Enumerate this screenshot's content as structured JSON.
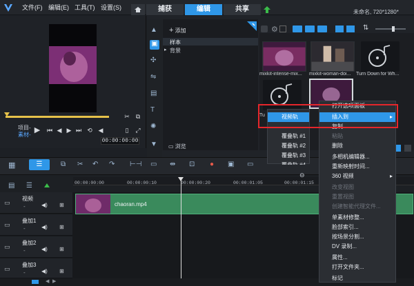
{
  "menubar": {
    "items": [
      "文件(F)",
      "编辑(E)",
      "工具(T)",
      "设置(S)"
    ]
  },
  "tabs": {
    "capture": "捕获",
    "edit": "编辑",
    "share": "共享"
  },
  "project_name": "未命名, 720*1280*",
  "player": {
    "project_label": "项目-",
    "clip_label": "素材-",
    "timecode": "00:00:00:00"
  },
  "library": {
    "add_label": "添加",
    "folders": [
      "样本",
      "背景"
    ],
    "browse_label": "浏览",
    "items": [
      {
        "label": "mixkit-intense-mix..."
      },
      {
        "label": "mixkit-woman-doi..."
      },
      {
        "label": "Turn Down for Wh..."
      },
      {
        "label": "Tu"
      },
      {
        "label": ""
      }
    ]
  },
  "timeline": {
    "ruler": [
      "00:00:00:00",
      "00:00:00:10",
      "00:00:00:20",
      "00:00:01:05",
      "00:00:01:15"
    ],
    "tracks": [
      {
        "name": "视频",
        "sub": "-"
      },
      {
        "name": "叠加1",
        "sub": "-"
      },
      {
        "name": "叠加2",
        "sub": "-"
      },
      {
        "name": "叠加3",
        "sub": "-"
      }
    ],
    "clip_name": "chaoran.mp4"
  },
  "context_menu_sub": {
    "items": [
      "视频轨",
      "覆叠轨 #1",
      "覆叠轨 #2",
      "覆叠轨 #3",
      "覆叠轨 #4"
    ]
  },
  "context_menu_main": {
    "top_item": "打开选项面板",
    "insert_to": "插入到",
    "items": [
      {
        "label": "复制",
        "disabled": false
      },
      {
        "label": "粘贴",
        "disabled": true
      },
      {
        "label": "删除",
        "disabled": false
      },
      {
        "label": "多相机编辑器...",
        "disabled": false
      },
      {
        "label": "重新映射时间...",
        "disabled": false
      },
      {
        "label": "360 视频",
        "disabled": false
      },
      {
        "label": "改变视图",
        "disabled": true
      },
      {
        "label": "重置视图",
        "disabled": true
      },
      {
        "label": "创建智能代理文件...",
        "disabled": true
      },
      {
        "label": "单素材修整...",
        "disabled": false
      },
      {
        "label": "脸部索引...",
        "disabled": false
      },
      {
        "label": "按场景分割...",
        "disabled": false
      },
      {
        "label": "DV 录制...",
        "disabled": false
      },
      {
        "label": "属性...",
        "disabled": false
      },
      {
        "label": "打开文件夹...",
        "disabled": false
      },
      {
        "label": "标记",
        "disabled": false
      }
    ]
  },
  "colors": {
    "accent": "#2f97e8",
    "highlight_box": "#e6262b",
    "clip": "#3a8a5c"
  }
}
